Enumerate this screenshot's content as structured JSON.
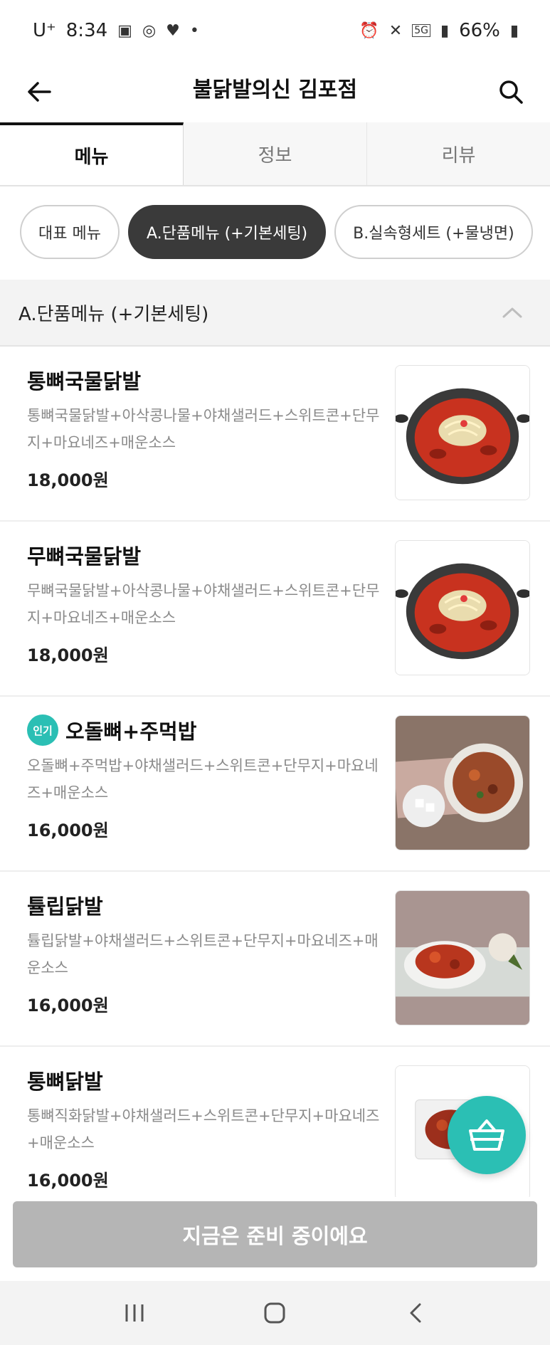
{
  "status_bar": {
    "carrier": "U⁺",
    "time": "8:34",
    "left_icons": [
      "screenshot-icon",
      "ring-icon",
      "heart-icon",
      "dot-icon"
    ],
    "network": "5G",
    "battery": "66%"
  },
  "header": {
    "title": "불닭발의신 김포점"
  },
  "tabs": [
    {
      "label": "메뉴",
      "active": true
    },
    {
      "label": "정보",
      "active": false
    },
    {
      "label": "리뷰",
      "active": false
    }
  ],
  "chips": [
    {
      "label": "대표 메뉴",
      "active": false
    },
    {
      "label": "A.단품메뉴 (+기본세팅)",
      "active": true
    },
    {
      "label": "B.실속형세트 (+물냉면)",
      "active": false
    }
  ],
  "section": {
    "title": "A.단품메뉴 (+기본세팅)"
  },
  "menu_items": [
    {
      "name": "통뼈국물닭발",
      "desc": "통뼈국물닭발+아삭콩나물+야채샐러드+스위트콘+단무지+마요네즈+매운소스",
      "price": "18,000원",
      "badge": "",
      "image": "soup-pot"
    },
    {
      "name": "무뼈국물닭발",
      "desc": "무뼈국물닭발+아삭콩나물+야채샐러드+스위트콘+단무지+마요네즈+매운소스",
      "price": "18,000원",
      "badge": "",
      "image": "soup-pot"
    },
    {
      "name": "오돌뼈+주먹밥",
      "desc": "오돌뼈+주먹밥+야채샐러드+스위트콘+단무지+마요네즈+매운소스",
      "price": "16,000원",
      "badge": "인기",
      "image": "plate-table"
    },
    {
      "name": "튤립닭발",
      "desc": "튤립닭발+야채샐러드+스위트콘+단무지+마요네즈+매운소스",
      "price": "16,000원",
      "badge": "",
      "image": "plate-cloth"
    },
    {
      "name": "통뼈닭발",
      "desc": "통뼈직화닭발+야채샐러드+스위트콘+단무지+마요네즈+매운소스",
      "price": "16,000원",
      "badge": "",
      "image": "plate-white"
    }
  ],
  "bottom_button": {
    "label": "지금은 준비 중이에요"
  },
  "colors": {
    "accent": "#2bbfb4",
    "chip_active": "#3a3a3a",
    "disabled_button": "#b5b5b5"
  }
}
